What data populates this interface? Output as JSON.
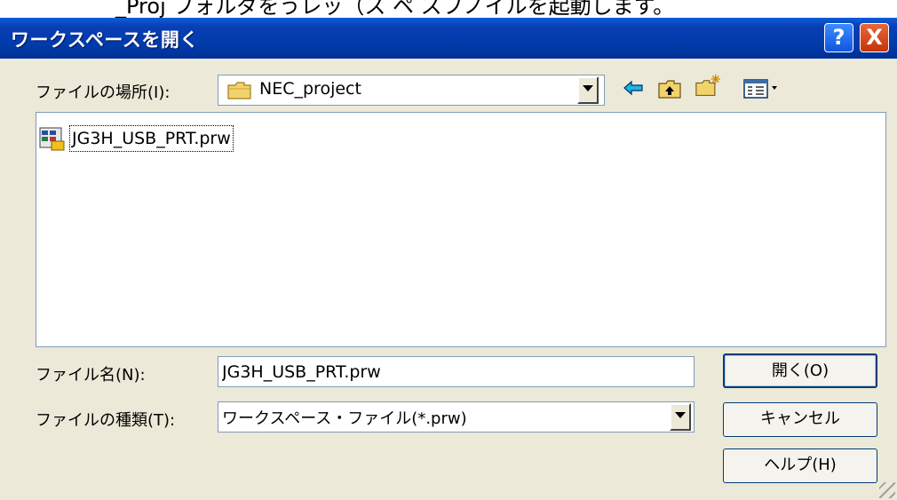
{
  "top_strip": {
    "text": "_Proj フォルダをうレッ（ス ペ スフノイルを起動します。"
  },
  "window": {
    "title": "ワークスペースを開く",
    "help_label": "?",
    "close_label": "X"
  },
  "location": {
    "label": "ファイルの場所(I):",
    "value": "NEC_project"
  },
  "toolbar": {
    "back_icon": "back-arrow-icon",
    "up_icon": "up-folder-icon",
    "new_folder_icon": "new-folder-icon",
    "view_icon": "view-menu-icon"
  },
  "files": [
    {
      "name": "JG3H_USB_PRT.prw",
      "icon": "workspace-file-icon"
    }
  ],
  "filename": {
    "label": "ファイル名(N):",
    "value": "JG3H_USB_PRT.prw"
  },
  "filetype": {
    "label": "ファイルの種類(T):",
    "value": "ワークスペース・ファイル(*.prw)"
  },
  "buttons": {
    "open": "開く(O)",
    "cancel": "キャンセル",
    "help": "ヘルプ(H)"
  },
  "colors": {
    "titlebar": "#0a3fb6",
    "dialog": "#ece9d8",
    "arrow": "#1fb4e0",
    "folder": "#f2d36b"
  }
}
